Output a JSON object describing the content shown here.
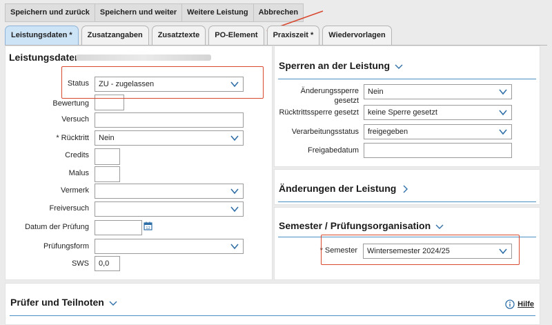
{
  "toolbar": {
    "save_back": "Speichern und zurück",
    "save_next": "Speichern und weiter",
    "further": "Weitere Leistung",
    "cancel": "Abbrechen"
  },
  "tabs": [
    {
      "label": "Leistungsdaten *",
      "active": true
    },
    {
      "label": "Zusatzangaben"
    },
    {
      "label": "Zusatztexte"
    },
    {
      "label": "PO-Element"
    },
    {
      "label": "Praxiszeit *"
    },
    {
      "label": "Wiedervorlagen"
    }
  ],
  "leistungsdaten": {
    "title": "Leistungsdaten",
    "status_label": "Status",
    "status_value": "ZU - zugelassen",
    "bewertung_label": "Bewertung",
    "bewertung_value": "",
    "versuch_label": "Versuch",
    "versuch_value": "",
    "ruecktritt_label": "* Rücktritt",
    "ruecktritt_value": "Nein",
    "credits_label": "Credits",
    "credits_value": "",
    "malus_label": "Malus",
    "malus_value": "",
    "vermerk_label": "Vermerk",
    "vermerk_value": "",
    "freiversuch_label": "Freiversuch",
    "freiversuch_value": "",
    "datum_label": "Datum der Prüfung",
    "datum_value": "",
    "pruefungsform_label": "Prüfungsform",
    "pruefungsform_value": "",
    "sws_label": "SWS",
    "sws_value": "0,0"
  },
  "sperren": {
    "title": "Sperren an der Leistung",
    "aenderung_label_1": "Änderungssperre",
    "aenderung_label_2": "gesetzt",
    "aenderung_value": "Nein",
    "ruecktritt_label": "Rücktrittssperre gesetzt",
    "ruecktritt_value": "keine Sperre gesetzt",
    "verarbeitung_label": "Verarbeitungsstatus",
    "verarbeitung_value": "freigegeben",
    "freigabe_label": "Freigabedatum",
    "freigabe_value": ""
  },
  "aenderungen": {
    "title": "Änderungen der Leistung"
  },
  "semester": {
    "title": "Semester / Prüfungsorganisation",
    "label": "* Semester",
    "value": "Wintersemester 2024/25"
  },
  "pruefer": {
    "title": "Prüfer und Teilnoten",
    "help": "Hilfe"
  },
  "colors": {
    "accent": "#4a8fc4",
    "annotation": "#d9472d",
    "tab_active": "#cde3f6"
  },
  "icons": [
    "chevron-down-icon",
    "chevron-right-icon",
    "calendar-icon",
    "info-icon"
  ]
}
